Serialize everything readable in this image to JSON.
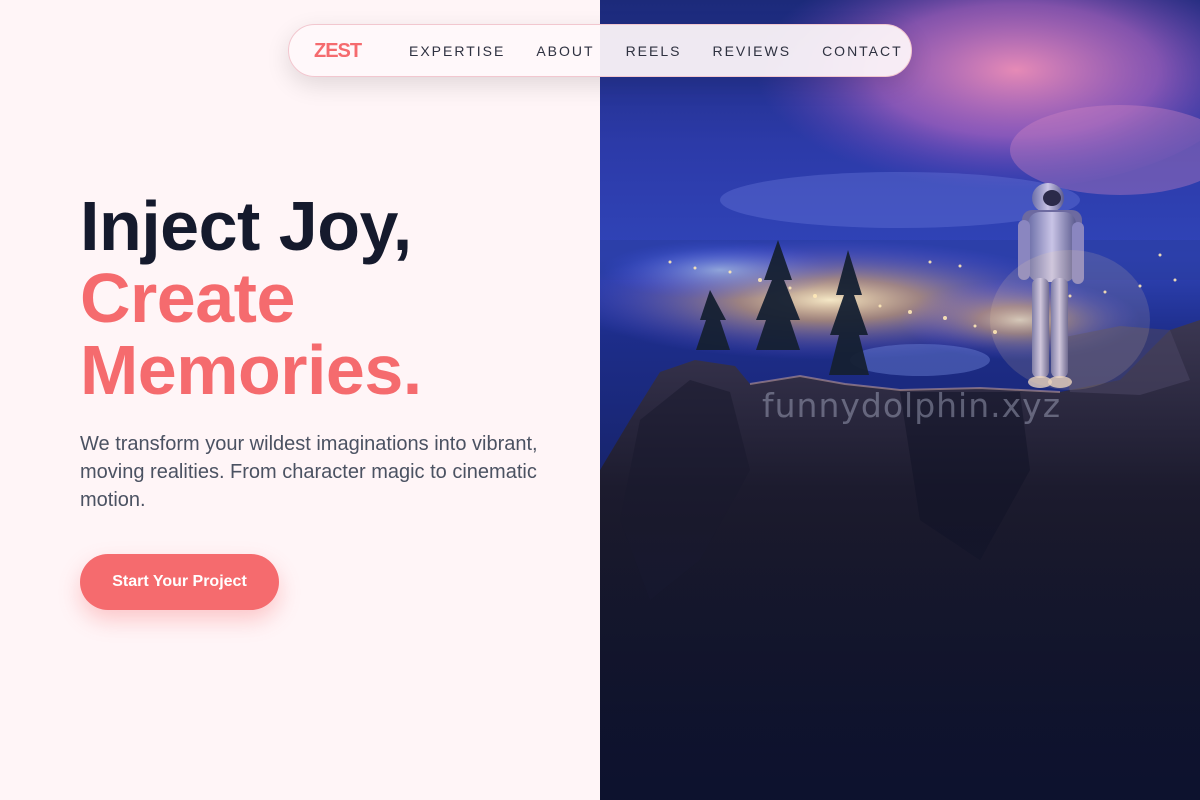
{
  "nav": {
    "logo": "ZEST",
    "links": [
      "EXPERTISE",
      "ABOUT",
      "REELS",
      "REVIEWS",
      "CONTACT"
    ]
  },
  "hero": {
    "headline_line1": "Inject Joy,",
    "headline_line2": "Create",
    "headline_line3": "Memories.",
    "subtitle": "We transform your wildest imaginations into vibrant, moving realities. From character magic to cinematic motion.",
    "cta_label": "Start Your Project"
  },
  "image": {
    "watermark": "funnydolphin.xyz"
  },
  "colors": {
    "accent": "#f56b6e",
    "heading": "#151a2d",
    "background": "#fff5f7",
    "body_text": "#4b5262"
  }
}
